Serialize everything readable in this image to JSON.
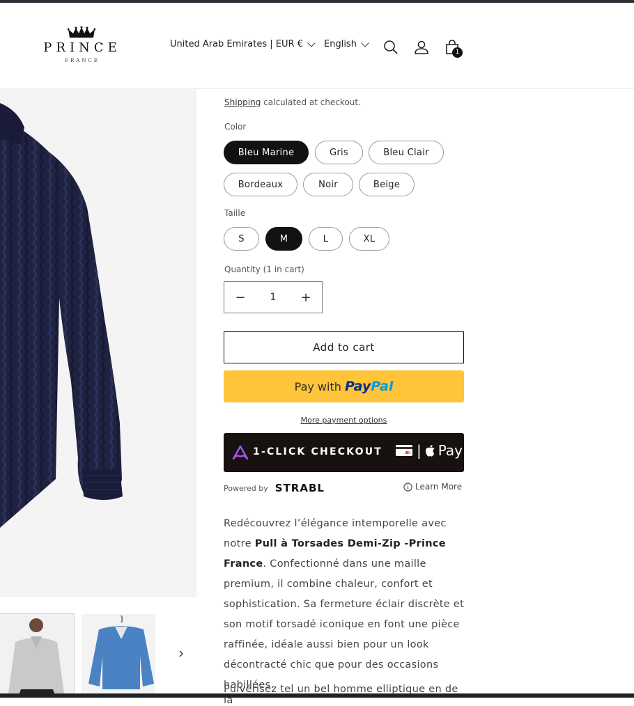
{
  "header": {
    "brand_name": "PRINCE",
    "brand_sub": "FRANCE",
    "country_label": "United Arab Emirates | EUR €",
    "language_label": "English",
    "cart_count": "1"
  },
  "product": {
    "shipping_link": "Shipping",
    "shipping_text": " calculated at checkout.",
    "color_label": "Color",
    "colors": [
      "Bleu Marine",
      "Gris",
      "Bleu Clair",
      "Bordeaux",
      "Noir",
      "Beige"
    ],
    "selected_color": "Bleu Marine",
    "size_label": "Taille",
    "sizes": [
      "S",
      "M",
      "L",
      "XL"
    ],
    "selected_size": "M",
    "quantity_label": "Quantity (1 in cart)",
    "quantity_value": "1",
    "add_to_cart": "Add to cart",
    "paypal_prefix": "Pay with",
    "paypal_brand_1": "Pay",
    "paypal_brand_2": "Pal",
    "more_payment": "More payment options",
    "one_click": "1-CLICK CHECKOUT",
    "apple_pay": "Pay",
    "powered_by": "Powered by",
    "powered_brand": "STRABL",
    "learn_more": "Learn More",
    "description_1": "Redécouvrez l’élégance intemporelle avec notre ",
    "description_bold": "Pull à Torsades Demi-Zip -Prince France",
    "description_2": ". Confectionné dans une maille premium, il combine chaleur, confort et sophistication. Sa fermeture éclair discrète et son motif torsadé iconique en font une pièce raffinée, idéale aussi bien pour un look décontracté chic que pour des occasions habillées.",
    "description_next": "Pulvérisez tel un bel homme elliptique en de la"
  },
  "colors": {
    "accent_dark": "#121212",
    "paypal_yellow": "#ffc43a",
    "strabl_purple": "#a855f7",
    "sweater_navy": "#1f2240"
  }
}
